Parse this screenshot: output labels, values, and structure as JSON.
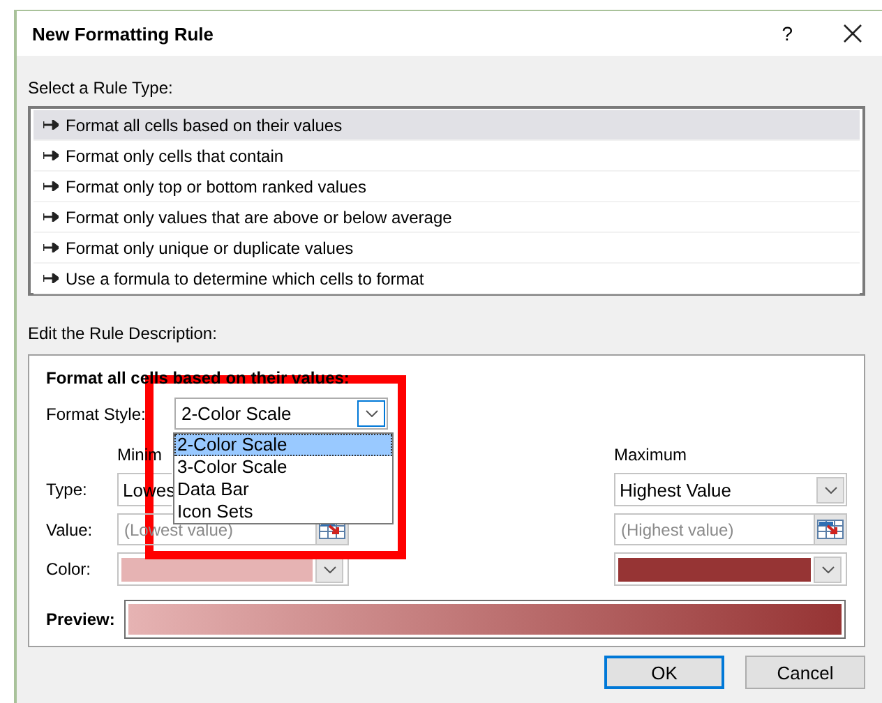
{
  "window": {
    "title": "New Formatting Rule",
    "help": "?"
  },
  "rule_type": {
    "label": "Select a Rule Type:",
    "items": [
      {
        "text": "Format all cells based on their values",
        "selected": true
      },
      {
        "text": "Format only cells that contain",
        "selected": false
      },
      {
        "text": "Format only top or bottom ranked values",
        "selected": false
      },
      {
        "text": "Format only values that are above or below average",
        "selected": false
      },
      {
        "text": "Format only unique or duplicate values",
        "selected": false
      },
      {
        "text": "Use a formula to determine which cells to format",
        "selected": false
      }
    ]
  },
  "description": {
    "label": "Edit the Rule Description:",
    "heading": "Format all cells based on their values:",
    "format_style": {
      "label": "Format Style:",
      "value": "2-Color Scale",
      "options": [
        {
          "text": "2-Color Scale",
          "selected": true
        },
        {
          "text": "3-Color Scale",
          "selected": false
        },
        {
          "text": "Data Bar",
          "selected": false
        },
        {
          "text": "Icon Sets",
          "selected": false
        }
      ]
    },
    "row_labels": {
      "type_label": "Type:",
      "value_label": "Value:",
      "color_label": "Color:"
    },
    "minimum": {
      "header": "Minim",
      "type": "Lowes",
      "value_placeholder": "(Lowest value)",
      "color": "#e6b3b3"
    },
    "maximum": {
      "header": "Maximum",
      "type": "Highest Value",
      "value_placeholder": "(Highest value)",
      "color": "#963434"
    },
    "preview": {
      "label": "Preview:"
    }
  },
  "buttons": [
    {
      "label": "OK",
      "default": true
    },
    {
      "label": "Cancel",
      "default": false
    }
  ]
}
